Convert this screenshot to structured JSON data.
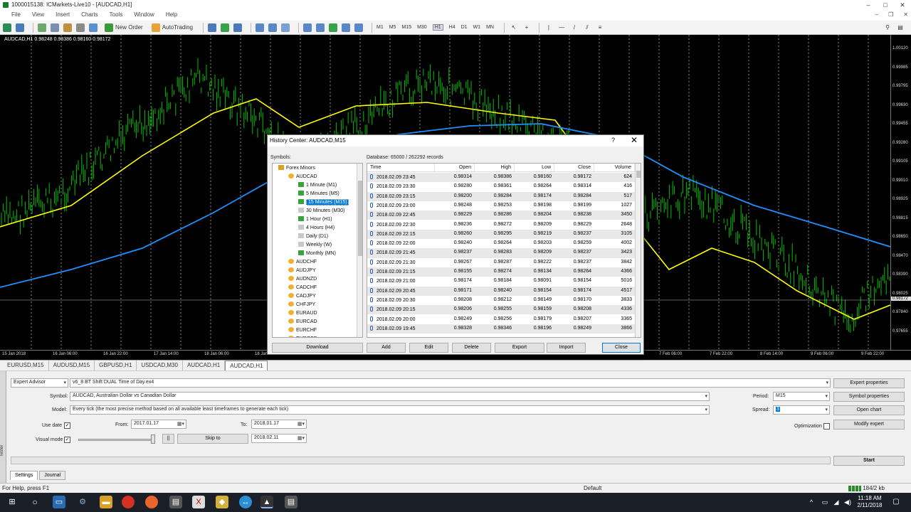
{
  "window": {
    "title": "1000015138: ICMarkets-Live10 - [AUDCAD,H1]",
    "controls": [
      "–",
      "□",
      "✕"
    ]
  },
  "menu": {
    "items": [
      "File",
      "View",
      "Insert",
      "Charts",
      "Tools",
      "Window",
      "Help"
    ],
    "mdi_controls": [
      "–",
      "❐",
      "✕"
    ]
  },
  "toolbar": {
    "new_order": "New Order",
    "autotrading": "AutoTrading",
    "periods": [
      "M1",
      "M5",
      "M15",
      "M30",
      "H1",
      "H4",
      "D1",
      "W1",
      "MN"
    ],
    "active_period": "H1"
  },
  "chart": {
    "label": "AUDCAD,H1  0.98248 0.98386 0.98160 0.98172",
    "last_price": "0.98172",
    "price_labels": [
      "1.00120",
      "0.99985",
      "0.99795",
      "0.99630",
      "0.99455",
      "0.99280",
      "0.99105",
      "0.99010",
      "0.98925",
      "0.98815",
      "0.98650",
      "0.98470",
      "0.98390",
      "0.98025",
      "0.97840",
      "0.97655"
    ],
    "time_labels": [
      "15 Jan 2018",
      "16 Jan 06:00",
      "16 Jan 22:00",
      "17 Jan 14:00",
      "18 Jan 06:00",
      "18 Jan 22:00",
      "19 Jan 14:00",
      "22 Jan 06:00",
      "22 Jan 22:00",
      "5 Feb 14:00",
      "5 Feb 06:00",
      "5 Feb 22:00",
      "6 Feb 14:00",
      "7 Feb 06:00",
      "7 Feb 22:00",
      "8 Feb 14:00",
      "9 Feb 06:00",
      "9 Feb 22:00"
    ],
    "colors": {
      "bull": "#00c000",
      "bear": "#00c000",
      "ma_fast": "#ffff00",
      "ma_slow": "#1e90ff",
      "grid": "#ffffff"
    }
  },
  "chart_tabs": {
    "items": [
      "EURUSD,M15",
      "AUDUSD,M15",
      "GBPUSD,H1",
      "USDCAD,M30",
      "AUDCAD,H1",
      "AUDCAD,H1"
    ],
    "active_index": 5
  },
  "tester": {
    "strip_label": "Tester",
    "mode": "Expert Advisor",
    "expert": "v6_8 BT Shift  DUAL Time of Day.ex4",
    "expert_properties": "Expert properties",
    "symbol_label": "Symbol:",
    "symbol": "AUDCAD, Australian Dollar vs Canadian Dollar",
    "period_label": "Period:",
    "period": "M15",
    "symbol_properties": "Symbol properties",
    "model_label": "Model:",
    "model": "Every tick (the most precise method based on all available least timeframes to generate each tick)",
    "spread_label": "Spread:",
    "spread": "3",
    "open_chart": "Open chart",
    "use_date_label": "Use date",
    "from_label": "From:",
    "from": "2017.01.17",
    "to_label": "To:",
    "to": "2018.01.17",
    "optimization_label": "Optimization",
    "modify_expert": "Modify expert",
    "visual_mode_label": "Visual mode",
    "pause": "||",
    "skip_to": "Skip to",
    "skip_date": "2018.02.11",
    "start": "Start",
    "tabs": [
      "Settings",
      "Journal"
    ]
  },
  "status": {
    "help": "For Help, press F1",
    "profile": "Default",
    "traffic": "184/2 kb"
  },
  "taskbar": {
    "time": "11:18 AM",
    "date": "2/11/2018"
  },
  "history_center": {
    "title": "History Center: AUDCAD,M15",
    "help_icon": "?",
    "close_x": "✕",
    "symbols_label": "Symbols:",
    "database": "Database: 65000 / 262292 records",
    "tree": [
      {
        "label": "Forex Minors",
        "level": 0,
        "type": "folder"
      },
      {
        "label": "AUDCAD",
        "level": 1,
        "type": "symbol"
      },
      {
        "label": "1 Minute (M1)",
        "level": 2,
        "type": "tf-green"
      },
      {
        "label": "5 Minutes (M5)",
        "level": 2,
        "type": "tf-green"
      },
      {
        "label": "15 Minutes (M15)",
        "level": 2,
        "type": "tf-green",
        "selected": true
      },
      {
        "label": "30 Minutes (M30)",
        "level": 2,
        "type": "tf-gray"
      },
      {
        "label": "1 Hour (H1)",
        "level": 2,
        "type": "tf-green"
      },
      {
        "label": "4 Hours (H4)",
        "level": 2,
        "type": "tf-gray"
      },
      {
        "label": "Daily (D1)",
        "level": 2,
        "type": "tf-gray"
      },
      {
        "label": "Weekly (W)",
        "level": 2,
        "type": "tf-gray"
      },
      {
        "label": "Monthly (MN)",
        "level": 2,
        "type": "tf-green"
      },
      {
        "label": "AUDCHF",
        "level": 1,
        "type": "symbol"
      },
      {
        "label": "AUDJPY",
        "level": 1,
        "type": "symbol"
      },
      {
        "label": "AUDNZD",
        "level": 1,
        "type": "symbol"
      },
      {
        "label": "CADCHF",
        "level": 1,
        "type": "symbol"
      },
      {
        "label": "CADJPY",
        "level": 1,
        "type": "symbol"
      },
      {
        "label": "CHFJPY",
        "level": 1,
        "type": "symbol"
      },
      {
        "label": "EURAUD",
        "level": 1,
        "type": "symbol"
      },
      {
        "label": "EURCAD",
        "level": 1,
        "type": "symbol"
      },
      {
        "label": "EURCHF",
        "level": 1,
        "type": "symbol"
      },
      {
        "label": "EURGBP",
        "level": 1,
        "type": "symbol"
      }
    ],
    "columns": [
      "Time",
      "Open",
      "High",
      "Low",
      "Close",
      "Volume"
    ],
    "rows": [
      [
        "2018.02.09 23:45",
        "0.98314",
        "0.98386",
        "0.98160",
        "0.98172",
        "624"
      ],
      [
        "2018.02.09 23:30",
        "0.98280",
        "0.98361",
        "0.98264",
        "0.98314",
        "416"
      ],
      [
        "2018.02.09 23:15",
        "0.98200",
        "0.98284",
        "0.98174",
        "0.98284",
        "517"
      ],
      [
        "2018.02.09 23:00",
        "0.98248",
        "0.98253",
        "0.98198",
        "0.98199",
        "1027"
      ],
      [
        "2018.02.09 22:45",
        "0.98229",
        "0.98286",
        "0.98204",
        "0.98238",
        "3450"
      ],
      [
        "2018.02.09 22:30",
        "0.98236",
        "0.98272",
        "0.98209",
        "0.98229",
        "2648"
      ],
      [
        "2018.02.09 22:15",
        "0.98260",
        "0.98295",
        "0.98219",
        "0.98237",
        "3105"
      ],
      [
        "2018.02.09 22:00",
        "0.98240",
        "0.98264",
        "0.98203",
        "0.98259",
        "4002"
      ],
      [
        "2018.02.09 21:45",
        "0.98237",
        "0.98283",
        "0.98209",
        "0.98237",
        "3423"
      ],
      [
        "2018.02.09 21:30",
        "0.98267",
        "0.98287",
        "0.98222",
        "0.98237",
        "3842"
      ],
      [
        "2018.02.09 21:15",
        "0.98155",
        "0.98274",
        "0.98134",
        "0.98264",
        "4366"
      ],
      [
        "2018.02.09 21:00",
        "0.98174",
        "0.98184",
        "0.98091",
        "0.98154",
        "5016"
      ],
      [
        "2018.02.09 20:45",
        "0.98171",
        "0.98240",
        "0.98154",
        "0.98174",
        "4517"
      ],
      [
        "2018.02.09 20:30",
        "0.98208",
        "0.98212",
        "0.98149",
        "0.98170",
        "3833"
      ],
      [
        "2018.02.09 20:15",
        "0.98206",
        "0.98255",
        "0.98159",
        "0.98208",
        "4336"
      ],
      [
        "2018.02.09 20:00",
        "0.98249",
        "0.98256",
        "0.98179",
        "0.98207",
        "3365"
      ],
      [
        "2018.02.09 19:45",
        "0.98328",
        "0.98346",
        "0.98196",
        "0.98249",
        "3866"
      ]
    ],
    "buttons": {
      "download": "Download",
      "add": "Add",
      "edit": "Edit",
      "delete": "Delete",
      "export": "Export",
      "import": "Import",
      "close": "Close"
    }
  }
}
